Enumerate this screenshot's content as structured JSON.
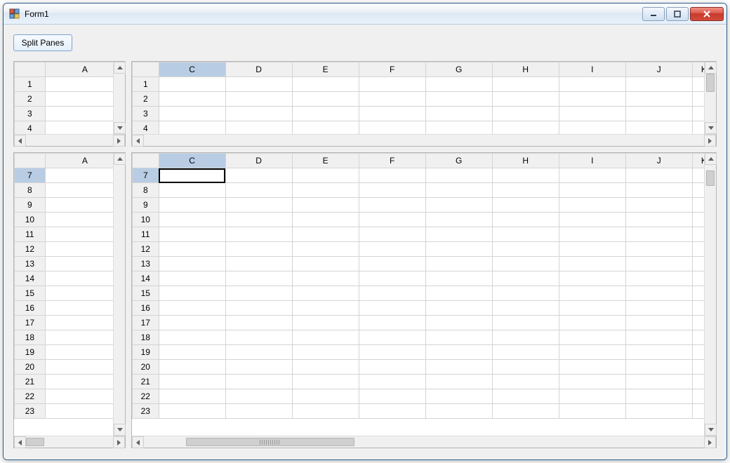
{
  "window": {
    "title": "Form1"
  },
  "buttons": {
    "split_panes": "Split Panes"
  },
  "columns_narrow": [
    "A"
  ],
  "columns_wide": [
    "C",
    "D",
    "E",
    "F",
    "G",
    "H",
    "I",
    "J",
    "K"
  ],
  "rows_top": [
    "1",
    "2",
    "3",
    "4"
  ],
  "rows_bottom": [
    "7",
    "8",
    "9",
    "10",
    "11",
    "12",
    "13",
    "14",
    "15",
    "16",
    "17",
    "18",
    "19",
    "20",
    "21",
    "22",
    "23"
  ],
  "selection": {
    "col_header": "C",
    "row_header": "7",
    "active_cell_pane": "bottom-right"
  },
  "chart_data": {
    "type": "table",
    "note": "Spreadsheet cells are empty; only headers and row numbers are visible.",
    "columns_left_panes": [
      "A"
    ],
    "columns_right_panes": [
      "C",
      "D",
      "E",
      "F",
      "G",
      "H",
      "I",
      "J",
      "K"
    ],
    "rows_top_panes": [
      1,
      2,
      3,
      4
    ],
    "rows_bottom_panes": [
      7,
      8,
      9,
      10,
      11,
      12,
      13,
      14,
      15,
      16,
      17,
      18,
      19,
      20,
      21,
      22,
      23
    ],
    "selected_cell": "C7"
  }
}
